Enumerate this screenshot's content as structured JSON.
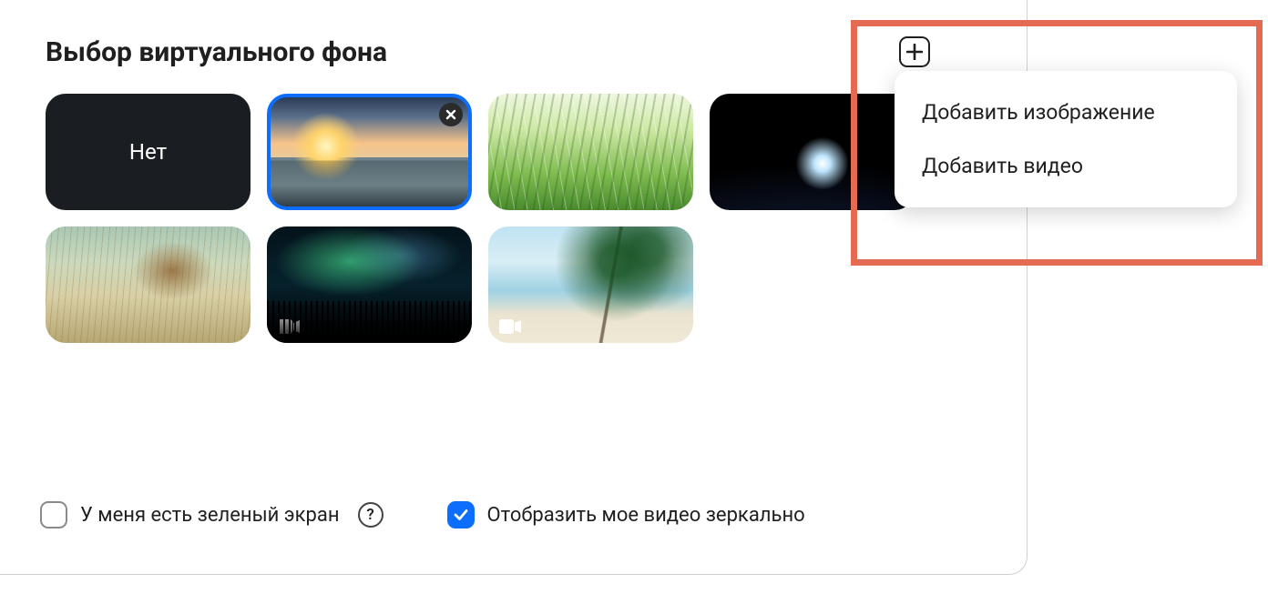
{
  "title": "Выбор виртуального фона",
  "none_label": "Нет",
  "add_icon": "plus-icon",
  "dropdown": {
    "add_image": "Добавить изображение",
    "add_video": "Добавить видео"
  },
  "thumbnails": [
    {
      "kind": "none"
    },
    {
      "kind": "image",
      "name": "golden-gate-bridge",
      "selected": true,
      "removable": true
    },
    {
      "kind": "image",
      "name": "grass"
    },
    {
      "kind": "image",
      "name": "earth-from-space"
    },
    {
      "kind": "image",
      "name": "mountain-lion-grassland"
    },
    {
      "kind": "video",
      "name": "aurora-borealis"
    },
    {
      "kind": "video",
      "name": "tropical-beach"
    }
  ],
  "footer": {
    "green_screen_label": "У меня есть зеленый экран",
    "green_screen_checked": false,
    "mirror_label": "Отобразить мое видео зеркально",
    "mirror_checked": true
  }
}
